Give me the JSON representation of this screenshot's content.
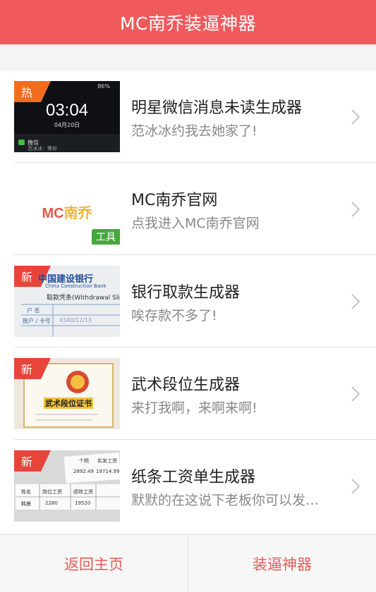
{
  "header": {
    "title": "MC南乔装逼神器"
  },
  "items": [
    {
      "title": "明星微信消息未读生成器",
      "desc": "范冰冰约我去她家了!",
      "badge": "热",
      "thumb": {
        "time": "03:04",
        "date": "04月20日",
        "battery": "86%",
        "app": "微信",
        "msg": "范冰冰：等你"
      }
    },
    {
      "title": "MC南乔官网",
      "desc": "点我进入MC南乔官网",
      "thumb": {
        "logo_a": "MC",
        "logo_b": "南乔",
        "tag": "工具"
      }
    },
    {
      "title": "银行取款生成器",
      "desc": "唉存款不多了!",
      "badge": "新",
      "thumb": {
        "bank": "中国建设银行",
        "bank_en": "China Construction Bank",
        "slip": "取款凭条(Withdrawal Slip",
        "row1": "户 名",
        "row2": "账户 / 卡号",
        "num": "4340/12/13"
      }
    },
    {
      "title": "武术段位生成器",
      "desc": "来打我啊，来啊来啊!",
      "badge": "新",
      "thumb": {
        "cert": "武术段位证书"
      }
    },
    {
      "title": "纸条工资单生成器",
      "desc": "默默的在这说下老板你可以发…",
      "badge": "新",
      "thumb": {
        "h1": "岗位工资",
        "h2": "绩效工资",
        "h3": "个税",
        "h4": "实发工资",
        "v1": "2280",
        "v2": "19520",
        "v3": "2892.49",
        "v4": "19714.99",
        "name": "姓名",
        "name_v": "韩晨"
      }
    }
  ],
  "footer": {
    "left": "返回主页",
    "right": "装逼神器"
  },
  "colors": {
    "brand": "#f05a5c",
    "badge_hot": "#f06d1d",
    "badge_new": "#e8443a",
    "tool": "#46a83c"
  }
}
